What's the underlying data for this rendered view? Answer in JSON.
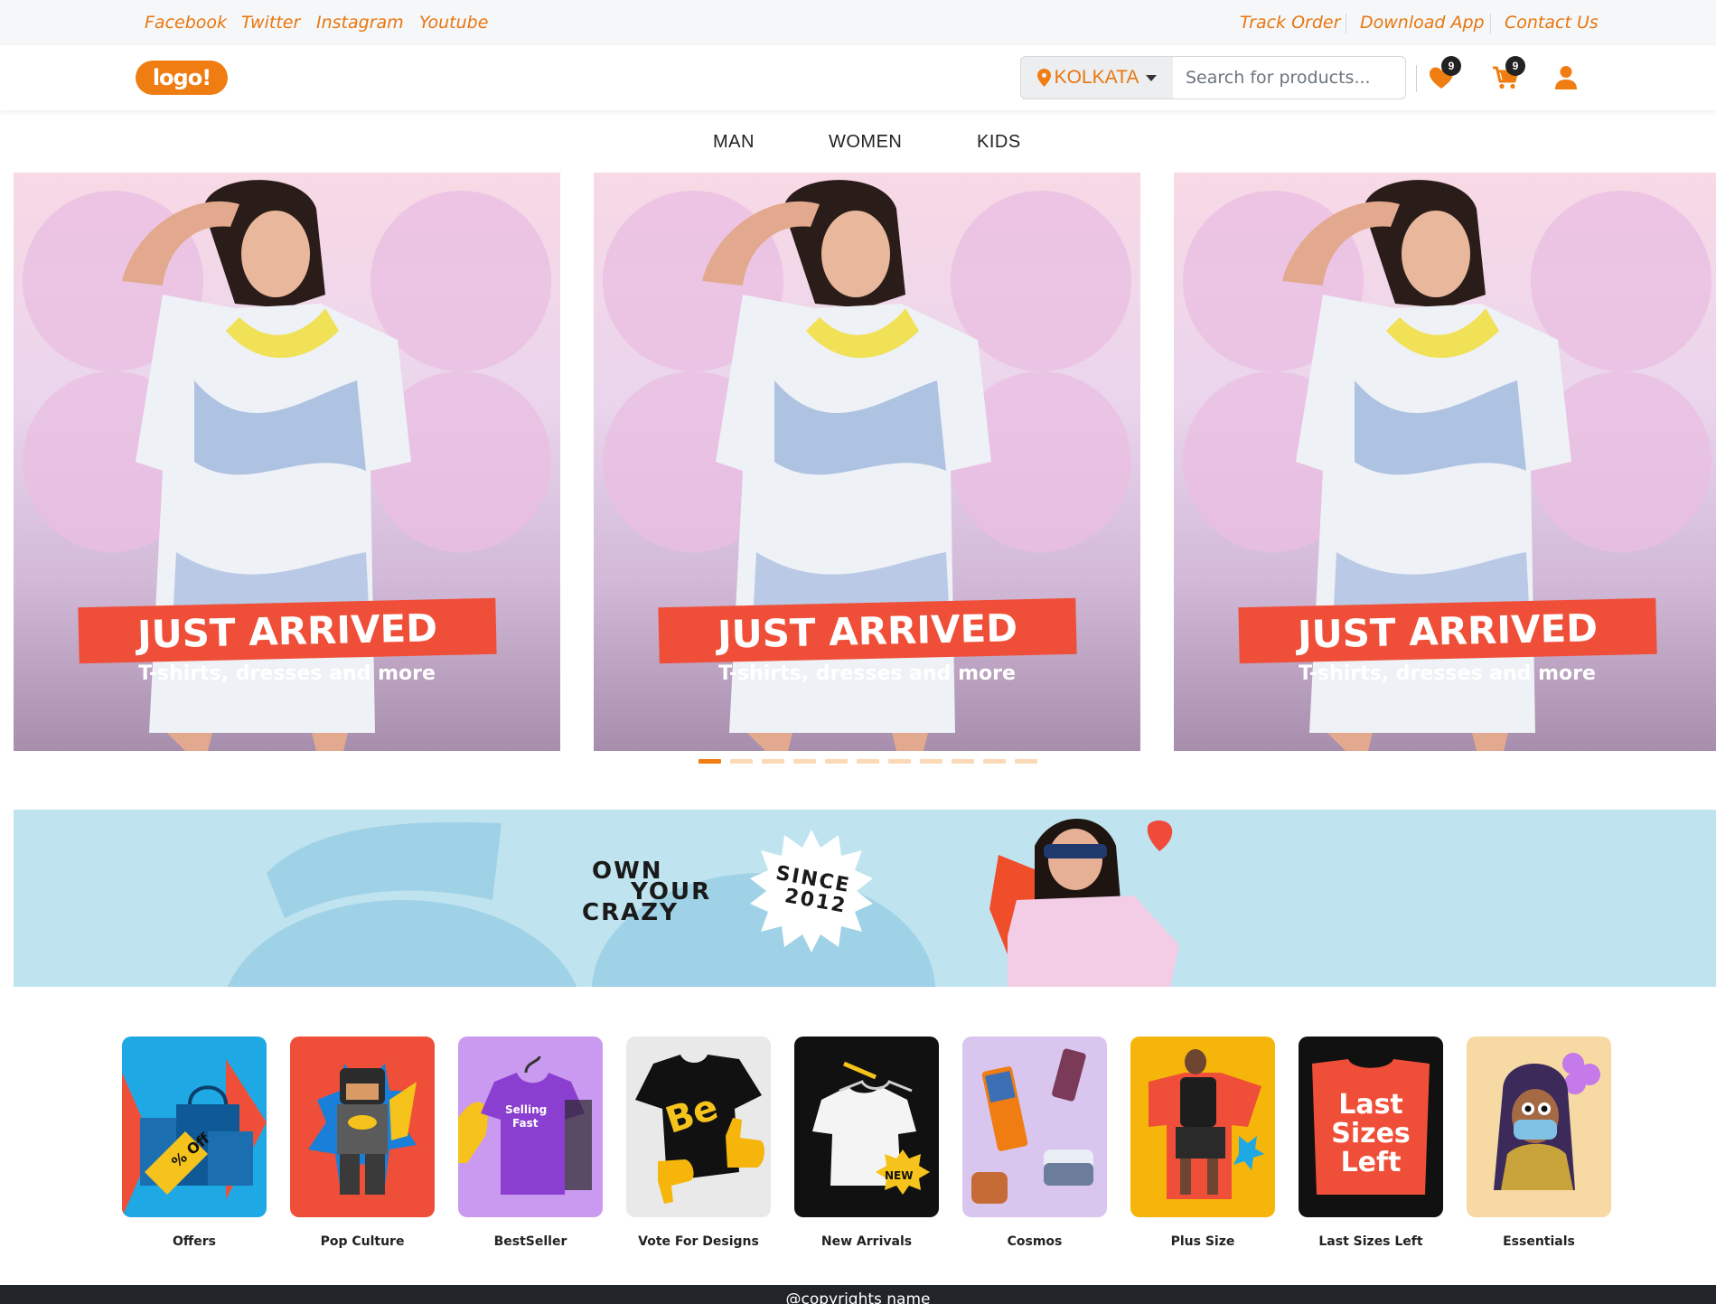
{
  "topbar": {
    "social_links": [
      "Facebook",
      "Twitter",
      "Instagram",
      "Youtube"
    ],
    "utility_links": [
      "Track Order",
      "Download App",
      "Contact Us"
    ]
  },
  "header": {
    "logo_text": "logo!",
    "location": "KOLKATA",
    "search_placeholder": "Search for products...",
    "wishlist_count": "9",
    "cart_count": "9"
  },
  "category_nav": [
    "MAN",
    "WOMEN",
    "KIDS"
  ],
  "slides": [
    {
      "title": "JUST ARRIVED",
      "subtitle": "T-shirts, dresses and more"
    },
    {
      "title": "JUST ARRIVED",
      "subtitle": "T-shirts, dresses and more"
    },
    {
      "title": "JUST ARRIVED",
      "subtitle": "T-shirts, dresses and more"
    }
  ],
  "carousel": {
    "total_slides": 11,
    "active_index": 0
  },
  "promo": {
    "line1": "OWN",
    "line2": "YOUR",
    "line3": "CRAZY",
    "badge_line1": "SINCE",
    "badge_line2": "2012"
  },
  "tiles": [
    {
      "label": "Offers",
      "art_text": "% Off",
      "bg": "#1fa9e4"
    },
    {
      "label": "Pop Culture",
      "art_text": "",
      "bg": "#ef4f38"
    },
    {
      "label": "BestSeller",
      "art_text": "Selling Fast",
      "bg": "#c99af0"
    },
    {
      "label": "Vote For Designs",
      "art_text": "Be",
      "bg": "#e9e9e9"
    },
    {
      "label": "New Arrivals",
      "art_text": "NEW",
      "bg": "#111111"
    },
    {
      "label": "Cosmos",
      "art_text": "",
      "bg": "#d9c6ef"
    },
    {
      "label": "Plus Size",
      "art_text": "",
      "bg": "#f5b50b"
    },
    {
      "label": "Last Sizes Left",
      "art_text": "Last Sizes Left",
      "bg": "#111111"
    },
    {
      "label": "Essentials",
      "art_text": "",
      "bg": "#f6d9a3"
    }
  ],
  "footer": {
    "copyright": "@copyrights name"
  },
  "colors": {
    "accent": "#ef7d12",
    "banner_red": "#ef4f38",
    "promo_bg": "#bfe3ef",
    "footer_bg": "#212529"
  }
}
